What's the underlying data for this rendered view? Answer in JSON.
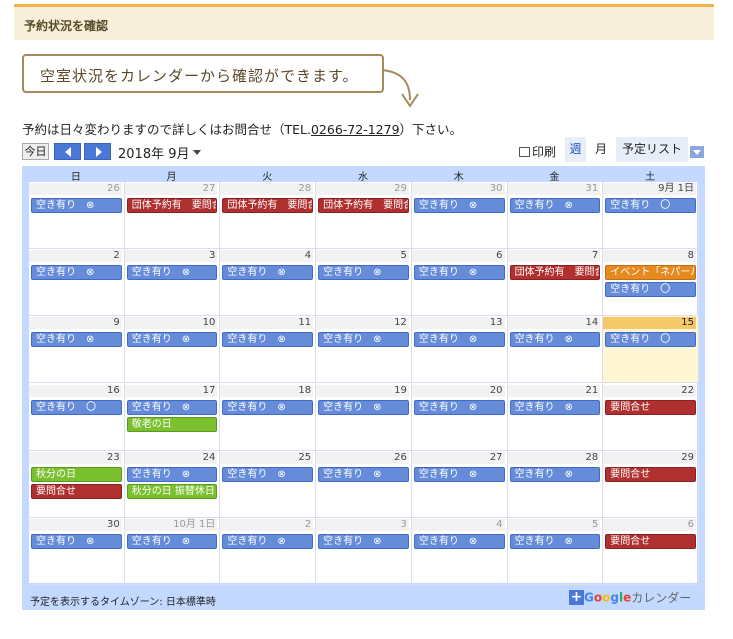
{
  "header": {
    "title": "予約状況を確認"
  },
  "callout": {
    "text": "空室状況をカレンダーから確認ができます。"
  },
  "notice": {
    "before": "予約は日々変わりますので詳しくはお問合せ（TEL.",
    "tel": "0266-72-1279",
    "after": "）下さい。"
  },
  "toolbar": {
    "today_label": "今日",
    "month_title": "2018年 9月",
    "print_label": "印刷",
    "week_label": "週",
    "month_label": "月",
    "list_label": "予定リスト"
  },
  "weekdays": [
    "日",
    "月",
    "火",
    "水",
    "木",
    "金",
    "土"
  ],
  "weeks": [
    {
      "days": [
        {
          "num": "26",
          "other": true,
          "events": [
            {
              "t": "空き有り　⊗",
              "c": "blue"
            }
          ]
        },
        {
          "num": "27",
          "other": true,
          "events": [
            {
              "t": "団体予約有　要問合せ",
              "c": "red"
            }
          ]
        },
        {
          "num": "28",
          "other": true,
          "events": [
            {
              "t": "団体予約有　要問合せ",
              "c": "red"
            }
          ]
        },
        {
          "num": "29",
          "other": true,
          "events": [
            {
              "t": "団体予約有　要問合せ",
              "c": "red"
            }
          ]
        },
        {
          "num": "30",
          "other": true,
          "events": [
            {
              "t": "空き有り　⊗",
              "c": "blue"
            }
          ]
        },
        {
          "num": "31",
          "other": true,
          "events": [
            {
              "t": "空き有り　⊗",
              "c": "blue"
            }
          ]
        },
        {
          "num": "9月 1日",
          "other": false,
          "events": [
            {
              "t": "空き有り　〇",
              "c": "blue"
            }
          ]
        }
      ]
    },
    {
      "days": [
        {
          "num": "2",
          "events": [
            {
              "t": "空き有り　⊗",
              "c": "blue"
            }
          ]
        },
        {
          "num": "3",
          "events": [
            {
              "t": "空き有り　⊗",
              "c": "blue"
            }
          ]
        },
        {
          "num": "4",
          "events": [
            {
              "t": "空き有り　⊗",
              "c": "blue"
            }
          ]
        },
        {
          "num": "5",
          "events": [
            {
              "t": "空き有り　⊗",
              "c": "blue"
            }
          ]
        },
        {
          "num": "6",
          "events": [
            {
              "t": "空き有り　⊗",
              "c": "blue"
            }
          ]
        },
        {
          "num": "7",
          "events": [
            {
              "t": "団体予約有　要問合せ",
              "c": "red"
            }
          ]
        },
        {
          "num": "8",
          "events": [
            {
              "t": "イベント「ネパール」",
              "c": "orange"
            },
            {
              "t": "空き有り　〇",
              "c": "blue"
            }
          ]
        }
      ]
    },
    {
      "days": [
        {
          "num": "9",
          "events": [
            {
              "t": "空き有り　⊗",
              "c": "blue"
            }
          ]
        },
        {
          "num": "10",
          "events": [
            {
              "t": "空き有り　⊗",
              "c": "blue"
            }
          ]
        },
        {
          "num": "11",
          "events": [
            {
              "t": "空き有り　⊗",
              "c": "blue"
            }
          ]
        },
        {
          "num": "12",
          "events": [
            {
              "t": "空き有り　⊗",
              "c": "blue"
            }
          ]
        },
        {
          "num": "13",
          "events": [
            {
              "t": "空き有り　⊗",
              "c": "blue"
            }
          ]
        },
        {
          "num": "14",
          "events": [
            {
              "t": "空き有り　⊗",
              "c": "blue"
            }
          ]
        },
        {
          "num": "15",
          "today": true,
          "events": [
            {
              "t": "空き有り　〇",
              "c": "blue"
            }
          ]
        }
      ]
    },
    {
      "days": [
        {
          "num": "16",
          "events": [
            {
              "t": "空き有り　〇",
              "c": "blue"
            }
          ]
        },
        {
          "num": "17",
          "events": [
            {
              "t": "空き有り　⊗",
              "c": "blue"
            },
            {
              "t": "敬老の日",
              "c": "green"
            }
          ]
        },
        {
          "num": "18",
          "events": [
            {
              "t": "空き有り　⊗",
              "c": "blue"
            }
          ]
        },
        {
          "num": "19",
          "events": [
            {
              "t": "空き有り　⊗",
              "c": "blue"
            }
          ]
        },
        {
          "num": "20",
          "events": [
            {
              "t": "空き有り　⊗",
              "c": "blue"
            }
          ]
        },
        {
          "num": "21",
          "events": [
            {
              "t": "空き有り　⊗",
              "c": "blue"
            }
          ]
        },
        {
          "num": "22",
          "events": [
            {
              "t": "要問合せ",
              "c": "red"
            }
          ]
        }
      ]
    },
    {
      "days": [
        {
          "num": "23",
          "events": [
            {
              "t": "秋分の日",
              "c": "green"
            },
            {
              "t": "要問合せ",
              "c": "red"
            }
          ]
        },
        {
          "num": "24",
          "events": [
            {
              "t": "空き有り　⊗",
              "c": "blue"
            },
            {
              "t": "秋分の日 振替休日",
              "c": "green"
            }
          ]
        },
        {
          "num": "25",
          "events": [
            {
              "t": "空き有り　⊗",
              "c": "blue"
            }
          ]
        },
        {
          "num": "26",
          "events": [
            {
              "t": "空き有り　⊗",
              "c": "blue"
            }
          ]
        },
        {
          "num": "27",
          "events": [
            {
              "t": "空き有り　⊗",
              "c": "blue"
            }
          ]
        },
        {
          "num": "28",
          "events": [
            {
              "t": "空き有り　⊗",
              "c": "blue"
            }
          ]
        },
        {
          "num": "29",
          "events": [
            {
              "t": "要問合せ",
              "c": "red"
            }
          ]
        }
      ]
    },
    {
      "days": [
        {
          "num": "30",
          "events": [
            {
              "t": "空き有り　⊗",
              "c": "blue"
            }
          ]
        },
        {
          "num": "10月 1日",
          "other": true,
          "events": [
            {
              "t": "空き有り　⊗",
              "c": "blue"
            }
          ]
        },
        {
          "num": "2",
          "other": true,
          "events": [
            {
              "t": "空き有り　⊗",
              "c": "blue"
            }
          ]
        },
        {
          "num": "3",
          "other": true,
          "events": [
            {
              "t": "空き有り　⊗",
              "c": "blue"
            }
          ]
        },
        {
          "num": "4",
          "other": true,
          "events": [
            {
              "t": "空き有り　⊗",
              "c": "blue"
            }
          ]
        },
        {
          "num": "5",
          "other": true,
          "events": [
            {
              "t": "空き有り　⊗",
              "c": "blue"
            }
          ]
        },
        {
          "num": "6",
          "other": true,
          "events": [
            {
              "t": "要問合せ",
              "c": "red"
            }
          ]
        }
      ]
    }
  ],
  "footer": {
    "timezone": "予定を表示するタイムゾーン: 日本標準時",
    "google": "Google",
    "calendar": "カレンダー"
  },
  "colors": {
    "blue": "#668cd9",
    "red": "#b02f2f",
    "green": "#7bc02e",
    "orange": "#e58a1e",
    "today": "#fff6d4"
  }
}
